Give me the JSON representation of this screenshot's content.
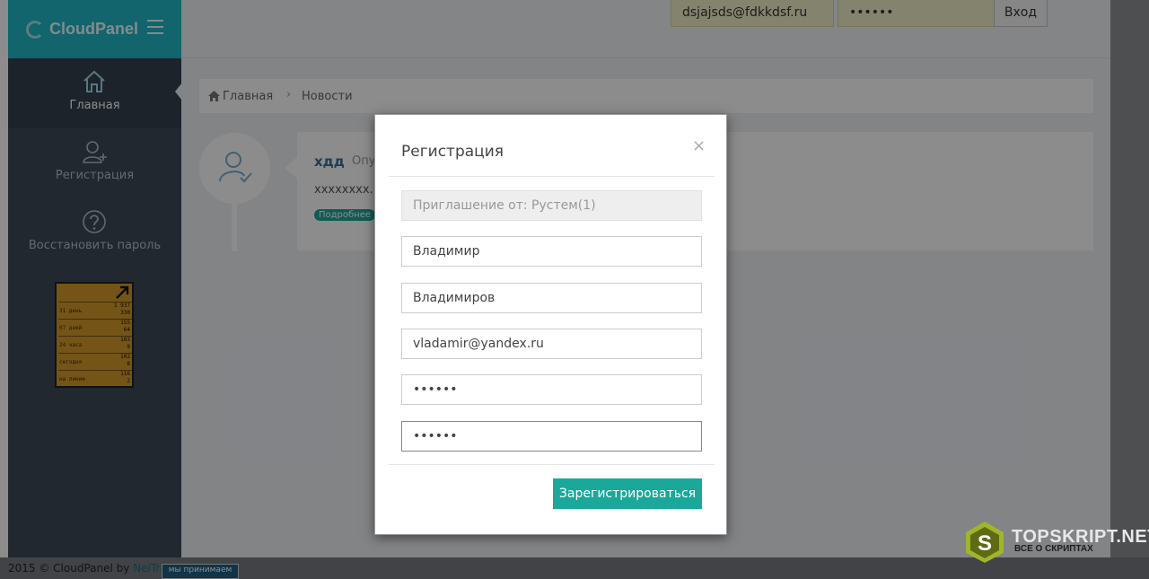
{
  "app": {
    "logo": "CloudPanel"
  },
  "header": {
    "login_value": "dsjajsds@fdkkdsf.ru",
    "password_mask": "••••••",
    "login_button": "Вход"
  },
  "sidebar": {
    "items": [
      {
        "label": "Главная",
        "icon": "home-icon",
        "active": true
      },
      {
        "label": "Регистрация",
        "icon": "user-plus-icon",
        "active": false
      },
      {
        "label": "Восстановить пароль",
        "icon": "question-icon",
        "active": false
      }
    ],
    "counter": {
      "rows": [
        {
          "label": "31 день",
          "value_a": "1 937",
          "value_b": "330"
        },
        {
          "label": "07 дней",
          "value_a": "155",
          "value_b": "64"
        },
        {
          "label": "24 часа",
          "value_a": "183",
          "value_b": "9"
        },
        {
          "label": "сегодня",
          "value_a": "102",
          "value_b": "8"
        },
        {
          "label": "на линии",
          "value_a": "116",
          "value_b": "2"
        }
      ]
    }
  },
  "breadcrumb": {
    "home": "Главная",
    "separator": "›",
    "current": "Новости"
  },
  "news": {
    "title": "хдд",
    "meta": "Опу",
    "text": "xxxxxxxx..",
    "more_label": "Подробнее"
  },
  "modal": {
    "title": "Регистрация",
    "close_glyph": "×",
    "invite": "Приглашение от: Рустем(1)",
    "first_name": "Владимир",
    "last_name": "Владимиров",
    "email": "vladamir@yandex.ru",
    "password": "••••••",
    "password_confirm": "••••••",
    "submit_label": "Зарегистрироваться"
  },
  "footer": {
    "copyright": "2015 © CloudPanel by ",
    "author": "NeiTral",
    "badge": "мы принимаем"
  },
  "watermark": {
    "title": "TOPSKRIPT.NET",
    "subtitle": "ВСЕ О СКРИПТАХ",
    "logo_letter": "S"
  },
  "colors": {
    "accent": "#1aa89a",
    "logo_bar": "#21b7c6",
    "sidebar": "#3c4a57"
  }
}
